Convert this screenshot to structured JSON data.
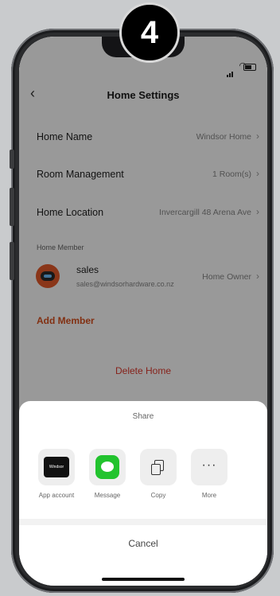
{
  "step": {
    "number": "4"
  },
  "header": {
    "title": "Home Settings"
  },
  "rows": [
    {
      "label": "Home Name",
      "value": "Windsor Home"
    },
    {
      "label": "Room Management",
      "value": "1 Room(s)"
    },
    {
      "label": "Home Location",
      "value": "Invercargill 48 Arena Ave"
    }
  ],
  "member_section": {
    "label": "Home Member"
  },
  "member": {
    "name": "sales",
    "email": "sales@windsorhardware.co.nz",
    "role": "Home Owner"
  },
  "add_member_label": "Add Member",
  "delete_home_label": "Delete Home",
  "share_sheet": {
    "title": "Share",
    "items": [
      {
        "label": "App account",
        "icon": "windsor-logo-icon",
        "tile_text": "Windsor"
      },
      {
        "label": "Message",
        "icon": "message-icon"
      },
      {
        "label": "Copy",
        "icon": "copy-icon"
      },
      {
        "label": "More",
        "icon": "more-icon",
        "glyph": "···"
      }
    ],
    "cancel_label": "Cancel"
  },
  "colors": {
    "accent_orange": "#d9501e",
    "delete_red": "#e03a2e",
    "message_green": "#22c32e"
  }
}
